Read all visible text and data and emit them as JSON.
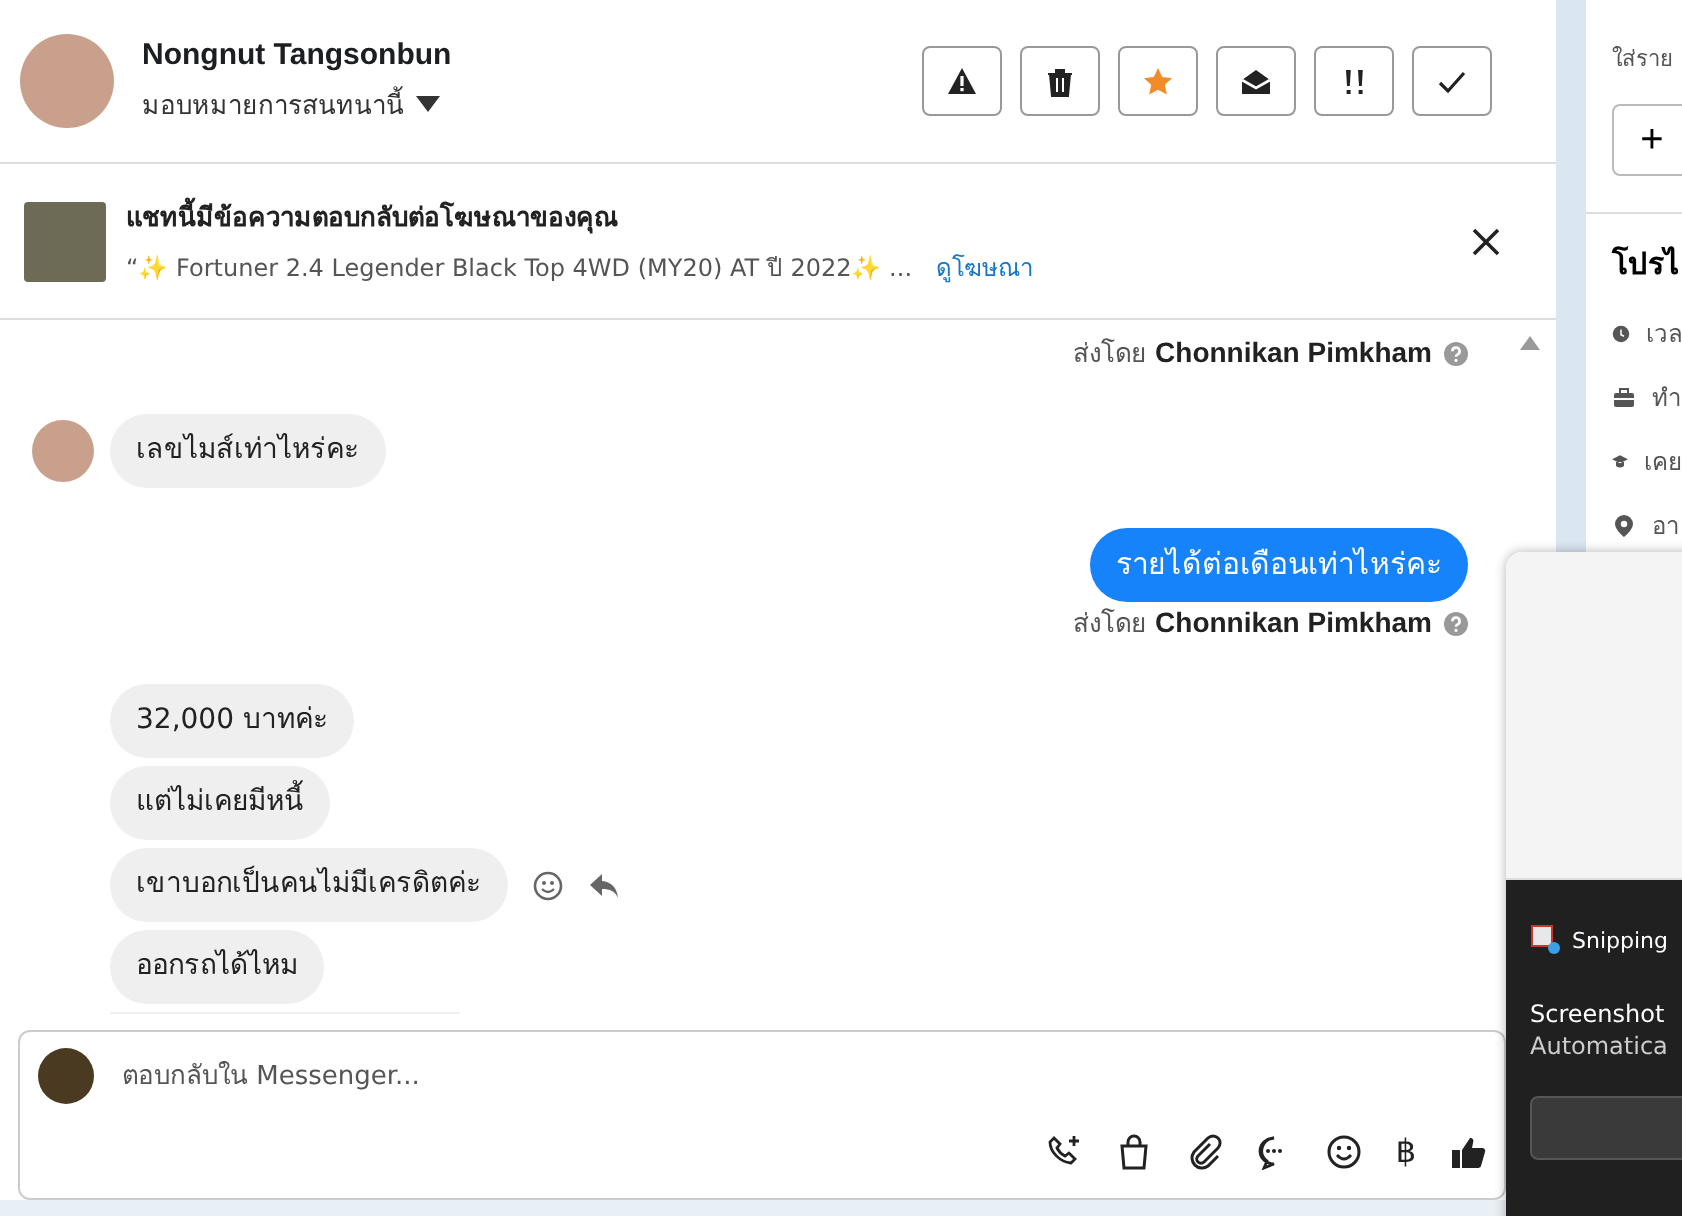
{
  "header": {
    "name": "Nongnut Tangsonbun",
    "assign_label": "มอบหมายการสนทนานี้",
    "actions": [
      {
        "kind": "warning",
        "on": false
      },
      {
        "kind": "trash",
        "on": false
      },
      {
        "kind": "star",
        "on": true
      },
      {
        "kind": "envelope",
        "on": false
      },
      {
        "kind": "exclaim",
        "on": false
      },
      {
        "kind": "check",
        "on": false
      }
    ]
  },
  "ad_banner": {
    "title": "แชทนี้มีข้อความตอบกลับต่อโฆษณาของคุณ",
    "description": "“✨ Fortuner 2.4 Legender Black Top 4WD (MY20) AT ปี 2022✨ ...",
    "link": "ดูโฆษณา"
  },
  "messages": [
    {
      "kind": "sent_by",
      "prefix": "ส่งโดย",
      "name": "Chonnikan Pimkham"
    },
    {
      "kind": "incoming",
      "text": "เลขไมส์เท่าไหร่คะ",
      "avatar": true,
      "hover_actions": false
    },
    {
      "kind": "outgoing",
      "text": "รายได้ต่อเดือนเท่าไหร่คะ"
    },
    {
      "kind": "sent_by",
      "prefix": "ส่งโดย",
      "name": "Chonnikan Pimkham"
    },
    {
      "kind": "incoming",
      "text": "32,000 บาทค่ะ",
      "avatar": false,
      "hover_actions": false
    },
    {
      "kind": "incoming",
      "text": "แต่ไม่เคยมีหนี้",
      "avatar": false,
      "hover_actions": false
    },
    {
      "kind": "incoming",
      "text": "เขาบอกเป็นคนไม่มีเครดิตค่ะ",
      "avatar": false,
      "hover_actions": true
    },
    {
      "kind": "incoming",
      "text": "ออกรถได้ไหม",
      "avatar": false,
      "hover_actions": false
    }
  ],
  "composer": {
    "placeholder": "ตอบกลับใน Messenger...",
    "tools": [
      {
        "kind": "call"
      },
      {
        "kind": "bag"
      },
      {
        "kind": "clip"
      },
      {
        "kind": "chat"
      },
      {
        "kind": "smile"
      },
      {
        "kind": "baht",
        "text": "฿"
      },
      {
        "kind": "like"
      }
    ]
  },
  "side_panel": {
    "hint": "ใส่ราย",
    "add": "+",
    "section": "โปรไ",
    "items": [
      {
        "kind": "clock",
        "text": "เวล"
      },
      {
        "kind": "work",
        "text": "ทำ"
      },
      {
        "kind": "school",
        "text": "เคย"
      },
      {
        "kind": "pin",
        "text": "อา"
      }
    ]
  },
  "toast": {
    "app": "Snipping",
    "title": "Screenshot",
    "body": "Automatica"
  }
}
